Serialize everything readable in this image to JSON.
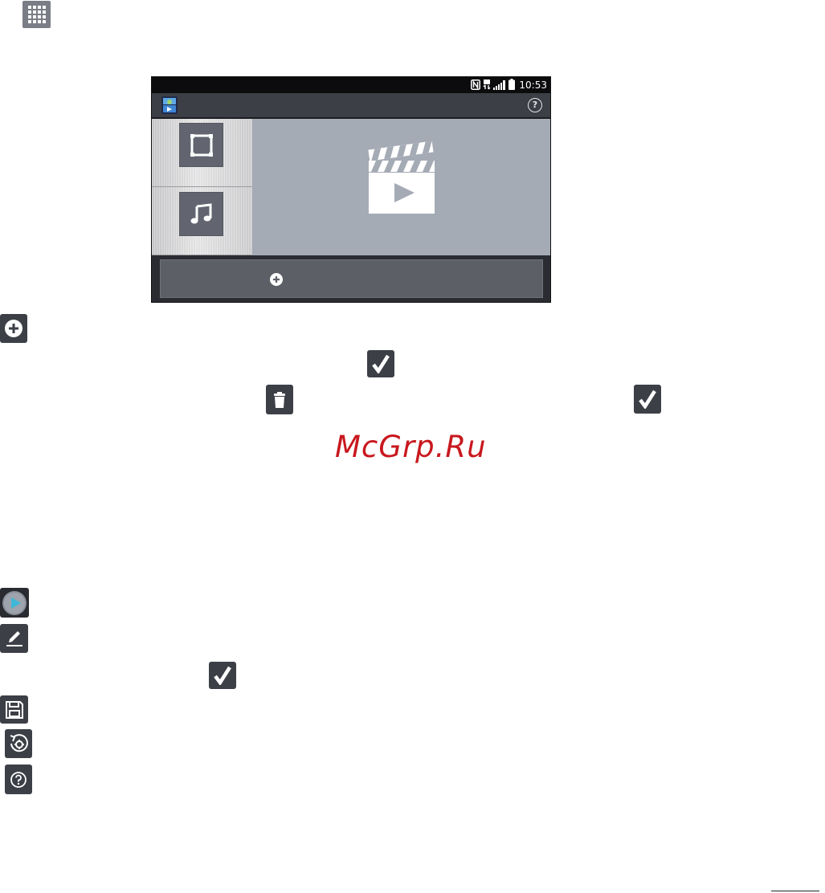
{
  "phone": {
    "status_bar": {
      "time": "10:53",
      "icons": [
        "nfc-icon",
        "data-icon",
        "signal-icon",
        "battery-icon"
      ]
    },
    "action_bar": {
      "app_icon": "video-editor-app-icon",
      "help_icon": "help-icon",
      "help_glyph": "?"
    },
    "side_panel": {
      "items": [
        {
          "icon": "frame-icon"
        },
        {
          "icon": "music-note-icon"
        }
      ]
    },
    "preview": {
      "icon": "clapperboard-play-icon"
    },
    "bottom_bar": {
      "icon": "add-circle-icon"
    }
  },
  "manual_icons": [
    "apps-grid-icon",
    "add-circle-icon",
    "checkmark-icon",
    "trash-icon",
    "checkmark-icon",
    "play-circle-icon",
    "edit-pencil-icon",
    "checkmark-icon",
    "save-icon",
    "reset-settings-icon",
    "help-icon"
  ],
  "watermark": {
    "text": "McGrp.Ru"
  },
  "colors": {
    "tile": "#3d3f47",
    "preview_bg": "#a5abb5",
    "watermark": "#c8181e"
  }
}
